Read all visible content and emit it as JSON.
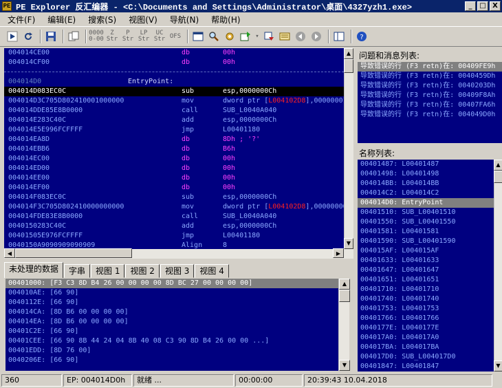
{
  "window": {
    "title": "PE Explorer 反汇编器 - <C:\\Documents and Settings\\Administrator\\桌面\\4327yzh1.exe>",
    "controls": [
      "_",
      "□",
      "X"
    ]
  },
  "menu": [
    "文件(F)",
    "编辑(E)",
    "搜索(S)",
    "视图(V)",
    "导航(N)",
    "帮助(H)"
  ],
  "toolbar": {
    "labels": [
      "0000\n0-00",
      "Z\nStr",
      "P\nStr",
      "LP\nStr",
      "UC\nStr",
      "OFS"
    ]
  },
  "disasm": {
    "rows": [
      {
        "addr": "004014CE",
        "hex": "00",
        "mn": "db",
        "op": "00h",
        "kind": "db"
      },
      {
        "addr": "004014CF",
        "hex": "00",
        "mn": "db",
        "op": "00h",
        "kind": "db"
      },
      {
        "addr": "",
        "hex": "",
        "mn": "",
        "op": "",
        "kind": "sep"
      },
      {
        "addr": "004014D0",
        "hex": "",
        "mn": "EntryPoint:",
        "op": "",
        "kind": "label"
      },
      {
        "addr": "004014D0",
        "hex": "83EC0C",
        "mn": "sub",
        "op": "esp,0000000Ch",
        "kind": "sel"
      },
      {
        "addr": "004014D3",
        "hex": "C705D802410001000000",
        "mn": "mov",
        "op": "dword ptr [",
        "op_red": "L004102D8",
        "op_tail": "],00000001h",
        "kind": "red"
      },
      {
        "addr": "004014DD",
        "hex": "E85E8B0000",
        "mn": "call",
        "op": "SUB_L0040A040",
        "kind": "n"
      },
      {
        "addr": "004014E2",
        "hex": "83C40C",
        "mn": "add",
        "op": "esp,0000000Ch",
        "kind": "n"
      },
      {
        "addr": "004014E5",
        "hex": "E996FCFFFF",
        "mn": "jmp",
        "op": "L00401180",
        "kind": "n"
      },
      {
        "addr": "004014EA",
        "hex": "8D",
        "mn": "db",
        "op": "8Dh ;  '?'",
        "kind": "db"
      },
      {
        "addr": "004014EB",
        "hex": "B6",
        "mn": "db",
        "op": "B6h",
        "kind": "db"
      },
      {
        "addr": "004014EC",
        "hex": "00",
        "mn": "db",
        "op": "00h",
        "kind": "db"
      },
      {
        "addr": "004014ED",
        "hex": "00",
        "mn": "db",
        "op": "00h",
        "kind": "db"
      },
      {
        "addr": "004014EE",
        "hex": "00",
        "mn": "db",
        "op": "00h",
        "kind": "db"
      },
      {
        "addr": "004014EF",
        "hex": "00",
        "mn": "db",
        "op": "00h",
        "kind": "db"
      },
      {
        "addr": "004014F0",
        "hex": "83EC0C",
        "mn": "sub",
        "op": "esp,0000000Ch",
        "kind": "n"
      },
      {
        "addr": "004014F3",
        "hex": "C705D802410000000000",
        "mn": "mov",
        "op": "dword ptr [",
        "op_red": "L004102D8",
        "op_tail": "],00000000h",
        "kind": "red"
      },
      {
        "addr": "004014FD",
        "hex": "E83E8B0000",
        "mn": "call",
        "op": "SUB_L0040A040",
        "kind": "n"
      },
      {
        "addr": "00401502",
        "hex": "83C40C",
        "mn": "add",
        "op": "esp,0000000Ch",
        "kind": "n"
      },
      {
        "addr": "00401505",
        "hex": "E976FCFFFF",
        "mn": "jmp",
        "op": "L00401180",
        "kind": "n"
      },
      {
        "addr": "0040150A",
        "hex": "9090909090909",
        "mn": "Align",
        "op": "8",
        "kind": "n"
      }
    ]
  },
  "problems": {
    "header": "问题和消息列表:",
    "items": [
      "导致错误的行 (F3 retn)在: 00409FE9h",
      "导致错误的行 (F3 retn)在: 0040459Dh",
      "导致错误的行 (F3 retn)在: 0040203Dh",
      "导致错误的行 (F3 retn)在: 00409F8Ah",
      "导致错误的行 (F3 retn)在: 00407FA6h",
      "导致错误的行 (F3 retn)在: 004049D0h"
    ]
  },
  "names": {
    "header": "名称列表:",
    "items": [
      "00401487:  L00401487",
      "00401498:  L00401498",
      "004014BB:  L004014BB",
      "004014C2:  L004014C2",
      "004014D0:  EntryPoint",
      "00401510:  SUB_L00401510",
      "00401550:  SUB_L00401550",
      "00401581:  L00401581",
      "00401590:  SUB_L00401590",
      "004015AF:  L004015AF",
      "00401633:  L00401633",
      "00401647:  L00401647",
      "00401651:  L00401651",
      "00401710:  L00401710",
      "00401740:  L00401740",
      "00401753:  L00401753",
      "00401766:  L00401766",
      "0040177E:  L0040177E",
      "004017A0:  L004017A0",
      "004017BA:  L004017BA",
      "004017D0:  SUB_L004017D0",
      "00401847:  L00401847"
    ],
    "highlight_index": 4
  },
  "tabs": [
    "未处理的数据",
    "字串",
    "视图 1",
    "视图 2",
    "视图 3",
    "视图 4"
  ],
  "raw": {
    "rows": [
      "00401000:  [F3 C3 8D B4 26 00 00 00 00 8D BC 27 00 00 00 00]",
      "004010AE:  [66 90]",
      "0040112E:  [66 90]",
      "004014CA:  [8D B6 00 00 00 00]",
      "004014EA:  [8D B6 00 00 00 00]",
      "00401C2E:  [66 90]",
      "00401CEE:  [66 90 8B 44 24 04 8B 40 08 C3 90 8D B4 26 00 00 ...]",
      "00401EDD:  [8D 76 00]",
      "0040206E:  [66 90]"
    ]
  },
  "status": {
    "count": "360",
    "ep": "EP: 004014D0h",
    "state": "就绪 ...",
    "time": "00:00:00",
    "datetime": "20:39:43 10.04.2018"
  }
}
